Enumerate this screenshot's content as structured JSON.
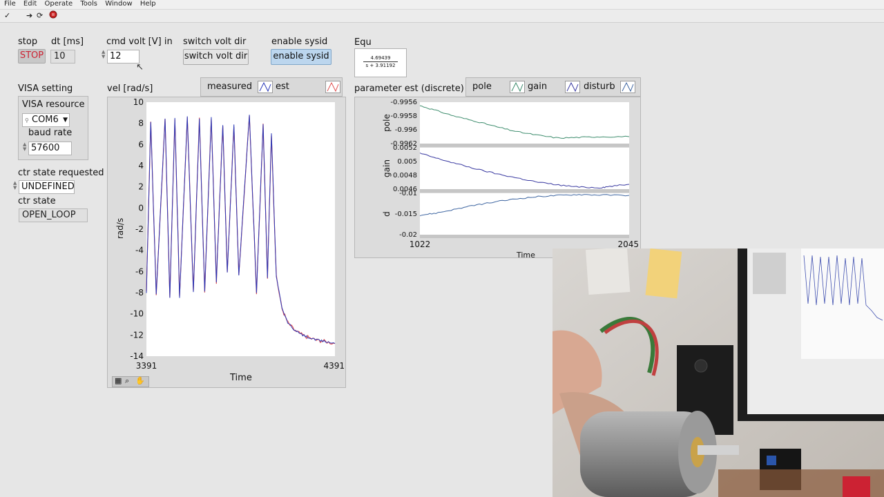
{
  "menu": [
    "File",
    "Edit",
    "Operate",
    "Tools",
    "Window",
    "Help"
  ],
  "toolbar": {
    "icons": [
      "check-icon",
      "run-arrow-icon",
      "run-continuous-icon",
      "abort-icon"
    ]
  },
  "stop": {
    "label": "stop",
    "button": "STOP"
  },
  "dt": {
    "label": "dt [ms]",
    "value": "10"
  },
  "cmd_volt": {
    "label": "cmd volt [V] in",
    "value": "12"
  },
  "switch_dir": {
    "label": "switch volt dir",
    "button": "switch volt dir"
  },
  "sysid": {
    "label": "enable sysid",
    "button": "enable sysid"
  },
  "equ": {
    "label": "Equ",
    "numerator": "4.69439",
    "denominator": "s + 3.91192"
  },
  "visa": {
    "title": "VISA setting",
    "resource_label": "VISA resource",
    "resource_value": "COM6",
    "baud_label": "baud rate",
    "baud_value": "57600"
  },
  "ctr_req": {
    "label": "ctr state requested",
    "value": "UNDEFINED"
  },
  "ctr_state": {
    "label": "ctr state",
    "value": "OPEN_LOOP"
  },
  "vel_graph": {
    "label": "vel [rad/s]",
    "legend": [
      "measured",
      "est"
    ],
    "ylabel": "rad/s",
    "xlabel": "Time"
  },
  "param_graph": {
    "label": "parameter est (discrete)",
    "legend": [
      "pole",
      "gain",
      "disturb"
    ],
    "xlabel": "Time"
  },
  "colors": {
    "measured": "#e05050",
    "est": "#2838b8",
    "pole": "#3c8c6c",
    "gain": "#3838a0",
    "disturb": "#3c64a0",
    "stop_text": "#cc2233",
    "sysid_bg": "#bcd6ee"
  },
  "chart_data": [
    {
      "type": "line",
      "title": "vel [rad/s]",
      "xlabel": "Time",
      "ylabel": "rad/s",
      "xlim": [
        3391,
        4391
      ],
      "ylim": [
        -14,
        10
      ],
      "x_ticks": [
        "3391",
        "4391"
      ],
      "y_ticks": [
        "10",
        "8",
        "6",
        "4",
        "2",
        "0",
        "-2",
        "-4",
        "-6",
        "-8",
        "-10",
        "-12",
        "-14"
      ],
      "series": [
        {
          "name": "measured",
          "x": [
            3391,
            3414,
            3443,
            3490,
            3515,
            3542,
            3567,
            3608,
            3640,
            3672,
            3700,
            3735,
            3762,
            3796,
            3820,
            3855,
            3881,
            3937,
            3975,
            4010,
            4033,
            4054,
            4080,
            4110,
            4140,
            4180,
            4220,
            4260,
            4300,
            4340,
            4391
          ],
          "y": [
            -8,
            8.2,
            -8.2,
            8.5,
            -8.4,
            8.5,
            -8.4,
            8.6,
            -7.9,
            8.4,
            -7.9,
            8.5,
            -7,
            7.9,
            -6.1,
            7.8,
            -6.4,
            8.9,
            -8,
            8,
            -6.6,
            7,
            -6.5,
            -9.5,
            -10.8,
            -11.6,
            -12,
            -12.3,
            -12.5,
            -12.6,
            -12.8
          ]
        },
        {
          "name": "est",
          "x": [
            3391,
            3414,
            3443,
            3490,
            3515,
            3542,
            3567,
            3608,
            3640,
            3672,
            3700,
            3735,
            3762,
            3796,
            3820,
            3855,
            3881,
            3937,
            3975,
            4010,
            4033,
            4054,
            4080,
            4110,
            4140,
            4180,
            4220,
            4260,
            4300,
            4340,
            4391
          ],
          "y": [
            -8,
            8.2,
            -8.2,
            8.5,
            -8.4,
            8.5,
            -8.4,
            8.6,
            -7.9,
            8.4,
            -7.9,
            8.5,
            -7,
            7.9,
            -6.1,
            7.8,
            -6.4,
            8.9,
            -8,
            8,
            -6.6,
            7,
            -6.5,
            -9.5,
            -10.8,
            -11.6,
            -12,
            -12.3,
            -12.5,
            -12.6,
            -12.8
          ]
        }
      ]
    },
    {
      "type": "line",
      "title": "pole",
      "ylabel": "pole",
      "xlim": [
        1022,
        2045
      ],
      "ylim": [
        -0.9962,
        -0.9956
      ],
      "y_ticks": [
        "-0.9956",
        "-0.9958",
        "-0.996",
        "-0.9962"
      ],
      "series": [
        {
          "name": "pole",
          "x": [
            1022,
            1100,
            1200,
            1300,
            1400,
            1500,
            1600,
            1700,
            1800,
            1900,
            2045
          ],
          "y": [
            -0.99565,
            -0.99572,
            -0.99581,
            -0.99588,
            -0.99596,
            -0.99603,
            -0.99608,
            -0.99612,
            -0.99611,
            -0.9961,
            -0.9961
          ]
        }
      ]
    },
    {
      "type": "line",
      "title": "gain",
      "ylabel": "gain",
      "xlim": [
        1022,
        2045
      ],
      "ylim": [
        0.0046,
        0.0052
      ],
      "y_ticks": [
        "0.0052",
        "0.005",
        "0.0048",
        "0.0046"
      ],
      "series": [
        {
          "name": "gain",
          "x": [
            1022,
            1100,
            1200,
            1300,
            1400,
            1500,
            1600,
            1700,
            1800,
            1900,
            1950,
            2045
          ],
          "y": [
            0.00512,
            0.00505,
            0.00497,
            0.00489,
            0.00482,
            0.00476,
            0.0047,
            0.00466,
            0.00463,
            0.00462,
            0.00464,
            0.00467
          ]
        }
      ]
    },
    {
      "type": "line",
      "title": "d",
      "ylabel": "d",
      "xlim": [
        1022,
        2045
      ],
      "ylim": [
        -0.02,
        -0.01
      ],
      "y_ticks": [
        "-0.01",
        "-0.015",
        "-0.02"
      ],
      "x_ticks": [
        "1022",
        "2045"
      ],
      "series": [
        {
          "name": "disturb",
          "x": [
            1022,
            1100,
            1200,
            1300,
            1400,
            1500,
            1600,
            1700,
            1800,
            1900,
            2045
          ],
          "y": [
            -0.0153,
            -0.0148,
            -0.0138,
            -0.0128,
            -0.012,
            -0.0113,
            -0.0108,
            -0.0105,
            -0.0103,
            -0.0104,
            -0.0105
          ]
        }
      ]
    }
  ]
}
